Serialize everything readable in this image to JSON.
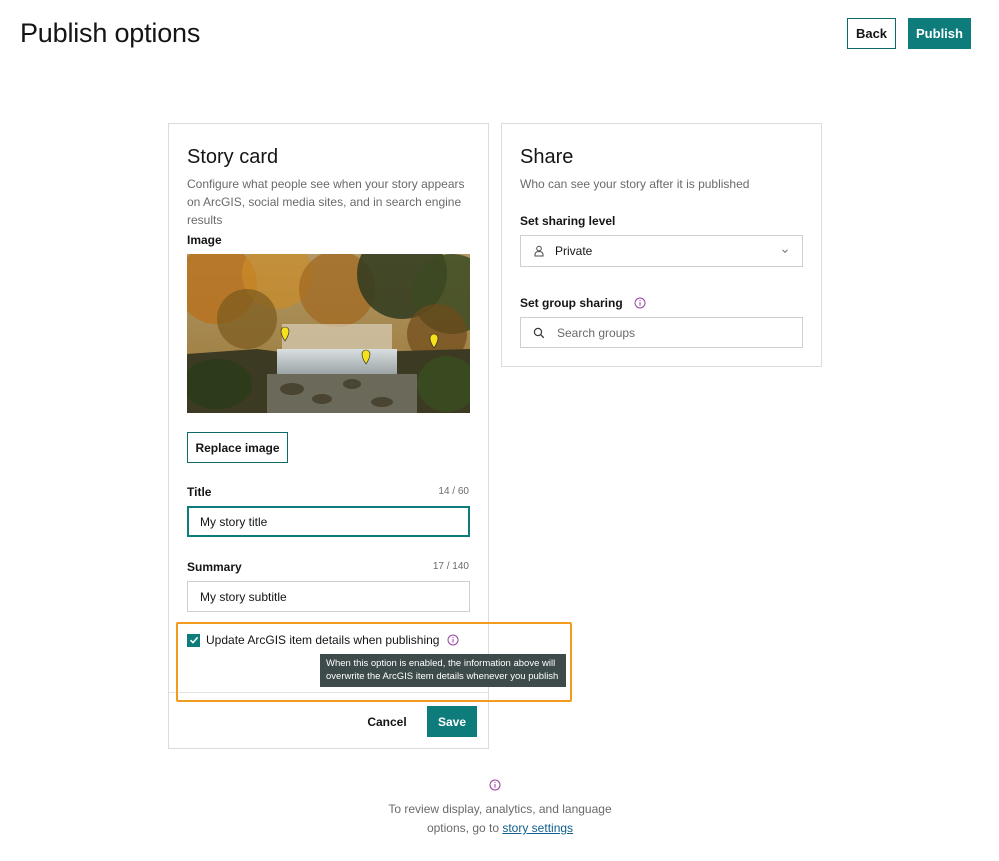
{
  "header": {
    "title": "Publish options",
    "back_label": "Back",
    "publish_label": "Publish"
  },
  "story_card": {
    "title": "Story card",
    "description": "Configure what people see when your story appears on ArcGIS, social media sites, and in search engine results",
    "image_label": "Image",
    "replace_image_label": "Replace image",
    "title_label": "Title",
    "title_counter": "14 / 60",
    "title_value": "My story title",
    "summary_label": "Summary",
    "summary_counter": "17 / 140",
    "summary_value": "My story subtitle",
    "update_checkbox_label": "Update ArcGIS item details when publishing",
    "update_checked": true,
    "tooltip": "When this option is enabled, the information above will overwrite the ArcGIS item details whenever you publish",
    "cancel_label": "Cancel",
    "save_label": "Save"
  },
  "share_card": {
    "title": "Share",
    "description": "Who can see your story after it is published",
    "sharing_level_label": "Set sharing level",
    "sharing_level_value": "Private",
    "group_sharing_label": "Set group sharing",
    "search_placeholder": "Search groups"
  },
  "footer": {
    "text_before": "To review display, analytics, and language options, go to ",
    "link_label": "story settings"
  },
  "colors": {
    "accent": "#0e7c7b",
    "info_icon": "#9a3fa3",
    "highlight": "#f29c1f",
    "tooltip_bg": "#3d4b4a"
  }
}
